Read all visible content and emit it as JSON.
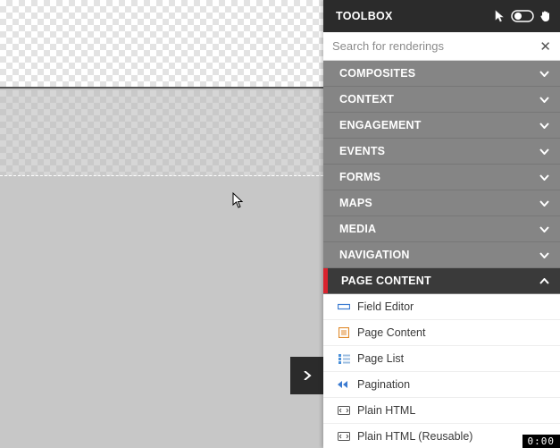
{
  "header": {
    "title": "TOOLBOX"
  },
  "search": {
    "placeholder": "Search for renderings"
  },
  "categories": [
    {
      "label": "COMPOSITES",
      "open": false
    },
    {
      "label": "CONTEXT",
      "open": false
    },
    {
      "label": "ENGAGEMENT",
      "open": false
    },
    {
      "label": "EVENTS",
      "open": false
    },
    {
      "label": "FORMS",
      "open": false
    },
    {
      "label": "MAPS",
      "open": false
    },
    {
      "label": "MEDIA",
      "open": false
    },
    {
      "label": "NAVIGATION",
      "open": false
    },
    {
      "label": "PAGE CONTENT",
      "open": true
    }
  ],
  "page_content_items": [
    {
      "label": "Field Editor",
      "icon": "field-editor"
    },
    {
      "label": "Page Content",
      "icon": "page-content"
    },
    {
      "label": "Page List",
      "icon": "page-list"
    },
    {
      "label": "Pagination",
      "icon": "pagination"
    },
    {
      "label": "Plain HTML",
      "icon": "plain-html"
    },
    {
      "label": "Plain HTML (Reusable)",
      "icon": "plain-html"
    }
  ],
  "timer": "0:00"
}
